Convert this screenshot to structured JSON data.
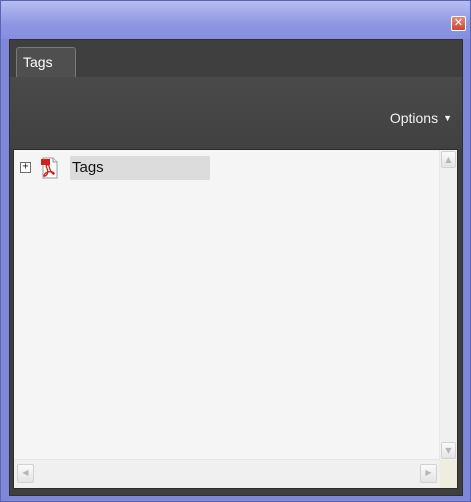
{
  "window": {
    "close_glyph": "✕"
  },
  "panel": {
    "tab_label": "Tags",
    "options_label": "Options",
    "options_caret": "▼"
  },
  "tree": {
    "root": {
      "expander": "+",
      "icon": "pdf-document-icon",
      "label": "Tags"
    }
  },
  "scrollbars": {
    "up": "▲",
    "down": "▼",
    "left": "◀",
    "right": "▶"
  },
  "colors": {
    "title_bar": "#8f97e2",
    "panel_dark": "#3f3f3f",
    "content_bg": "#f5f5f5",
    "selection": "#dcdcdc",
    "pdf_red": "#d41f1f"
  }
}
